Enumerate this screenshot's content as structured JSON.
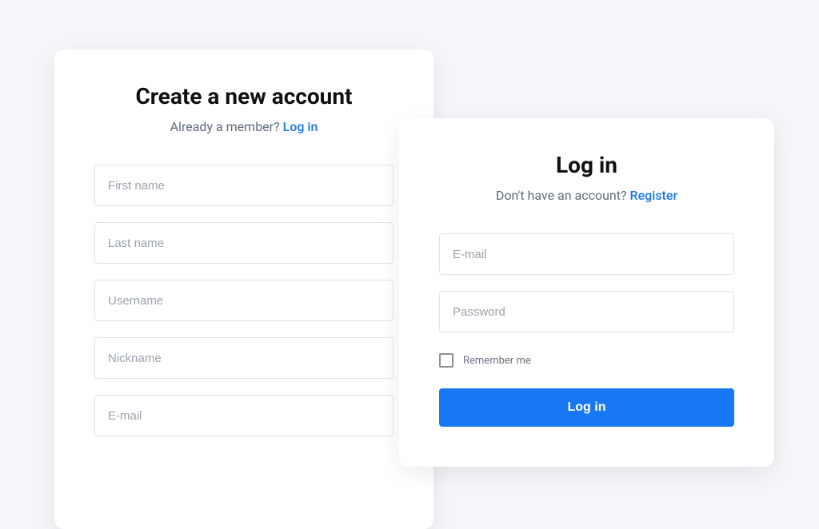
{
  "signup": {
    "title": "Create a new account",
    "subtitle_prefix": "Already a member? ",
    "subtitle_link": "Log in",
    "fields": {
      "first_name": "First name",
      "last_name": "Last name",
      "username": "Username",
      "nickname": "Nickname",
      "email": "E-mail"
    }
  },
  "login": {
    "title": "Log in",
    "subtitle_prefix": "Don't have an account? ",
    "subtitle_link": "Register",
    "fields": {
      "email": "E-mail",
      "password": "Password"
    },
    "remember_label": "Remember me",
    "submit_label": "Log in"
  },
  "colors": {
    "accent": "#1877f2"
  }
}
